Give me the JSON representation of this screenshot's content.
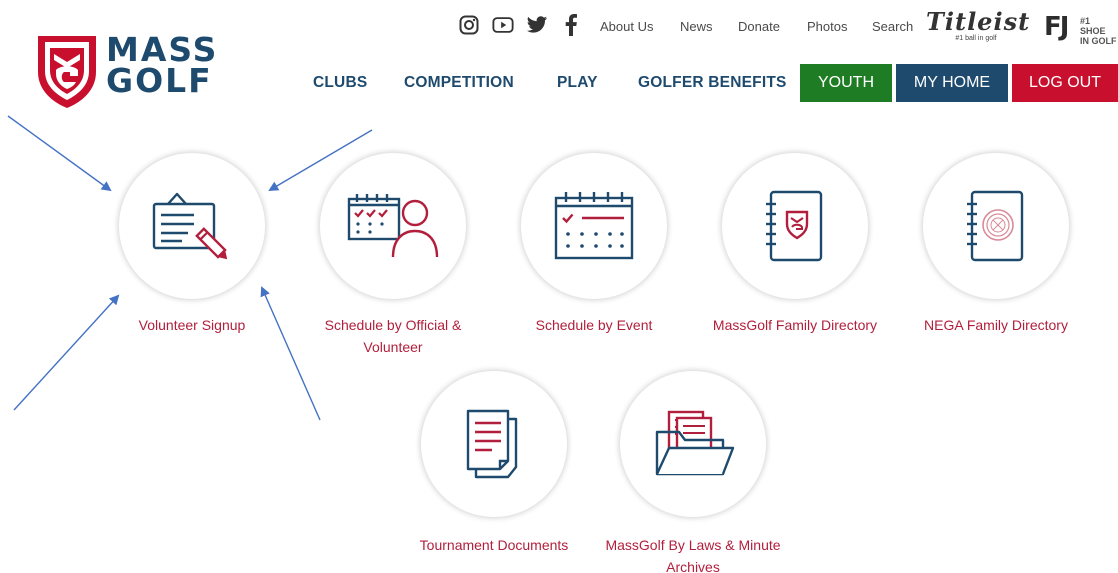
{
  "logo": {
    "line1": "MASS",
    "line2": "GOLF"
  },
  "utility": {
    "social_icons": [
      "instagram-icon",
      "youtube-icon",
      "twitter-icon",
      "facebook-icon"
    ],
    "links": [
      "About Us",
      "News",
      "Donate",
      "Photos",
      "Search"
    ]
  },
  "sponsors": {
    "titleist": {
      "word": "Titleist",
      "tagline": "#1 ball in golf"
    },
    "fj": {
      "mark": "FJ",
      "tagline_1": "#1 SHOE",
      "tagline_2": "IN GOLF"
    }
  },
  "nav": {
    "items": [
      "CLUBS",
      "COMPETITION",
      "PLAY",
      "GOLFER BENEFITS"
    ],
    "buttons": {
      "youth": "YOUTH",
      "home": "MY HOME",
      "logout": "LOG OUT"
    }
  },
  "tiles": [
    {
      "label": "Volunteer Signup",
      "icon": "clipboard-pencil-icon"
    },
    {
      "label": "Schedule by Official & Volunteer",
      "icon": "calendar-person-icon"
    },
    {
      "label": "Schedule by Event",
      "icon": "calendar-icon"
    },
    {
      "label": "MassGolf Family Directory",
      "icon": "notebook-shield-icon"
    },
    {
      "label": "NEGA Family Directory",
      "icon": "notebook-seal-icon"
    },
    {
      "label": "Tournament Documents",
      "icon": "documents-icon"
    },
    {
      "label": "MassGolf By Laws & Minute Archives",
      "icon": "folder-icon"
    }
  ],
  "colors": {
    "brand_blue": "#1e4a6e",
    "brand_red": "#c8102e",
    "youth_green": "#1e7d24",
    "annotation_arrow": "#4472c4"
  }
}
